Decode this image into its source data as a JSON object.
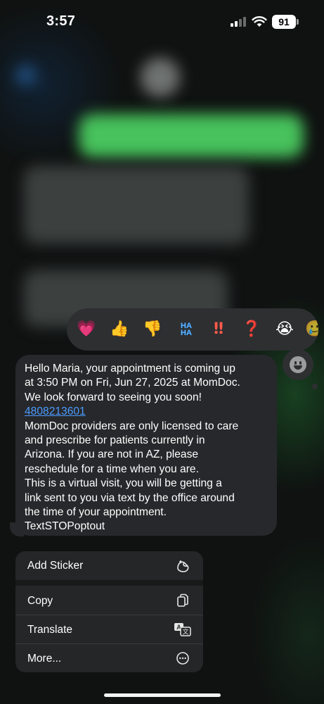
{
  "status_bar": {
    "time": "3:57",
    "battery": "91"
  },
  "reactions": {
    "items": [
      {
        "name": "heart",
        "glyph": "💗"
      },
      {
        "name": "thumbs-up",
        "glyph": "👍"
      },
      {
        "name": "thumbs-down",
        "glyph": "👎"
      },
      {
        "name": "haha",
        "glyph": "HA\nHA"
      },
      {
        "name": "exclamation",
        "glyph": "‼"
      },
      {
        "name": "question",
        "glyph": "❓"
      },
      {
        "name": "crying",
        "glyph": "😭"
      }
    ]
  },
  "message": {
    "line1": "Hello Maria, your appointment is coming up",
    "line2": "at 3:50 PM on Fri, Jun 27, 2025 at MomDoc.",
    "line3": "We look forward to seeing you soon!",
    "phone": "4808213601",
    "line5": "MomDoc providers are only licensed to care",
    "line6": "and prescribe for patients currently in",
    "line7": "Arizona. If you are not in AZ, please",
    "line8": "reschedule for a time when you are.",
    "line9": "This is a virtual visit, you will be getting a",
    "line10": "link sent to you via text by the office around",
    "line11": "the time of your appointment.",
    "line12": "TextSTOPoptout"
  },
  "menu": {
    "add_sticker": "Add Sticker",
    "copy": "Copy",
    "translate": "Translate",
    "more": "More..."
  }
}
